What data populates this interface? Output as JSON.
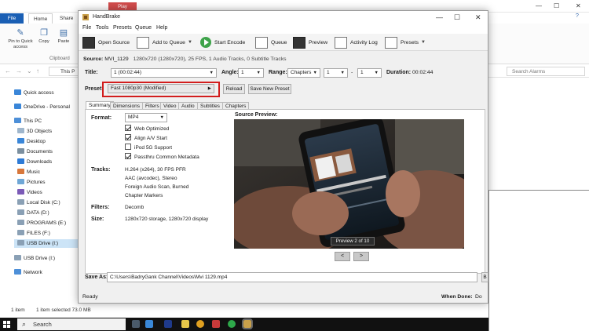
{
  "explorer": {
    "play_tab": "Play",
    "tabs": {
      "file": "File",
      "home": "Home",
      "share": "Share"
    },
    "ribbon": {
      "pin": "Pin to Quick access",
      "copy": "Copy",
      "paste": "Paste",
      "group": "Clipboard"
    },
    "address": "This P",
    "search_placeholder": "Search Alarms",
    "nav": [
      {
        "label": "Quick access",
        "color": "#3a86d8"
      },
      {
        "label": "OneDrive - Personal",
        "color": "#3a86d8"
      },
      {
        "label": "This PC",
        "color": "#4d8fd8"
      },
      {
        "label": "3D Objects",
        "color": "#9fb6cc"
      },
      {
        "label": "Desktop",
        "color": "#3a86d8"
      },
      {
        "label": "Documents",
        "color": "#7b8f9f"
      },
      {
        "label": "Downloads",
        "color": "#2e7bd6"
      },
      {
        "label": "Music",
        "color": "#d8773a"
      },
      {
        "label": "Pictures",
        "color": "#6fa7d6"
      },
      {
        "label": "Videos",
        "color": "#7b5ab7"
      },
      {
        "label": "Local Disk (C:)",
        "color": "#8aa0b5"
      },
      {
        "label": "DATA (D:)",
        "color": "#8aa0b5"
      },
      {
        "label": "PROGRAMS (E:)",
        "color": "#8aa0b5"
      },
      {
        "label": "FILES (F:)",
        "color": "#8aa0b5"
      },
      {
        "label": "USB Drive (I:)",
        "color": "#8aa0b5"
      },
      {
        "label": "USB Drive (I:)",
        "color": "#8aa0b5"
      },
      {
        "label": "Network",
        "color": "#4d8fd8"
      }
    ],
    "status": {
      "items": "1 item",
      "selected": "1 item selected  73.0 MB"
    }
  },
  "handbrake": {
    "title": "HandBrake",
    "menu": [
      "File",
      "Tools",
      "Presets",
      "Queue",
      "Help"
    ],
    "toolbar": {
      "open_source": "Open Source",
      "add_to_queue": "Add to Queue",
      "start_encode": "Start Encode",
      "queue": "Queue",
      "preview": "Preview",
      "activity_log": "Activity Log",
      "presets": "Presets"
    },
    "source": {
      "label": "Source:",
      "name": "MVI_1129",
      "info": "1280x720 (1280x720), 25 FPS, 1 Audio Tracks, 0 Subtitle Tracks"
    },
    "title_row": {
      "title_label": "Title:",
      "title_value": "1 (00:02:44)",
      "angle_label": "Angle:",
      "angle_value": "1",
      "range_label": "Range:",
      "range_value": "Chapters",
      "range_from": "1",
      "range_dash": "-",
      "range_to": "1",
      "duration_label": "Duration:",
      "duration_value": "00:02:44"
    },
    "preset": {
      "label": "Preset:",
      "value": "Fast 1080p30  (Modified)",
      "reload": "Reload",
      "save_new": "Save New Preset"
    },
    "tabs": [
      "Summary",
      "Dimensions",
      "Filters",
      "Video",
      "Audio",
      "Subtitles",
      "Chapters"
    ],
    "summary": {
      "format_label": "Format:",
      "format_value": "MP4",
      "options": [
        {
          "label": "Web Optimized",
          "checked": true
        },
        {
          "label": "Align A/V Start",
          "checked": true
        },
        {
          "label": "iPod 5G Support",
          "checked": false
        },
        {
          "label": "Passthru Common Metadata",
          "checked": true
        }
      ],
      "tracks_label": "Tracks:",
      "tracks": [
        "H.264 (x264), 30 FPS PFR",
        "AAC (avcodec), Stereo",
        "Foreign Audio Scan, Burned",
        "Chapter Markers"
      ],
      "filters_label": "Filters:",
      "filters_value": "Decomb",
      "size_label": "Size:",
      "size_value": "1280x720 storage, 1280x720 display",
      "preview_title": "Source Preview:",
      "preview_caption": "Preview 2 of 10",
      "prev": "<",
      "next": ">"
    },
    "save_as": {
      "label": "Save As:",
      "path": "C:\\Users\\BadryGank Channel\\Videos\\Mvi 1129.mp4",
      "browse": "B"
    },
    "status": {
      "ready": "Ready",
      "when_done_label": "When Done:",
      "when_done_value": "Do"
    }
  },
  "taskbar": {
    "search": "Search"
  }
}
